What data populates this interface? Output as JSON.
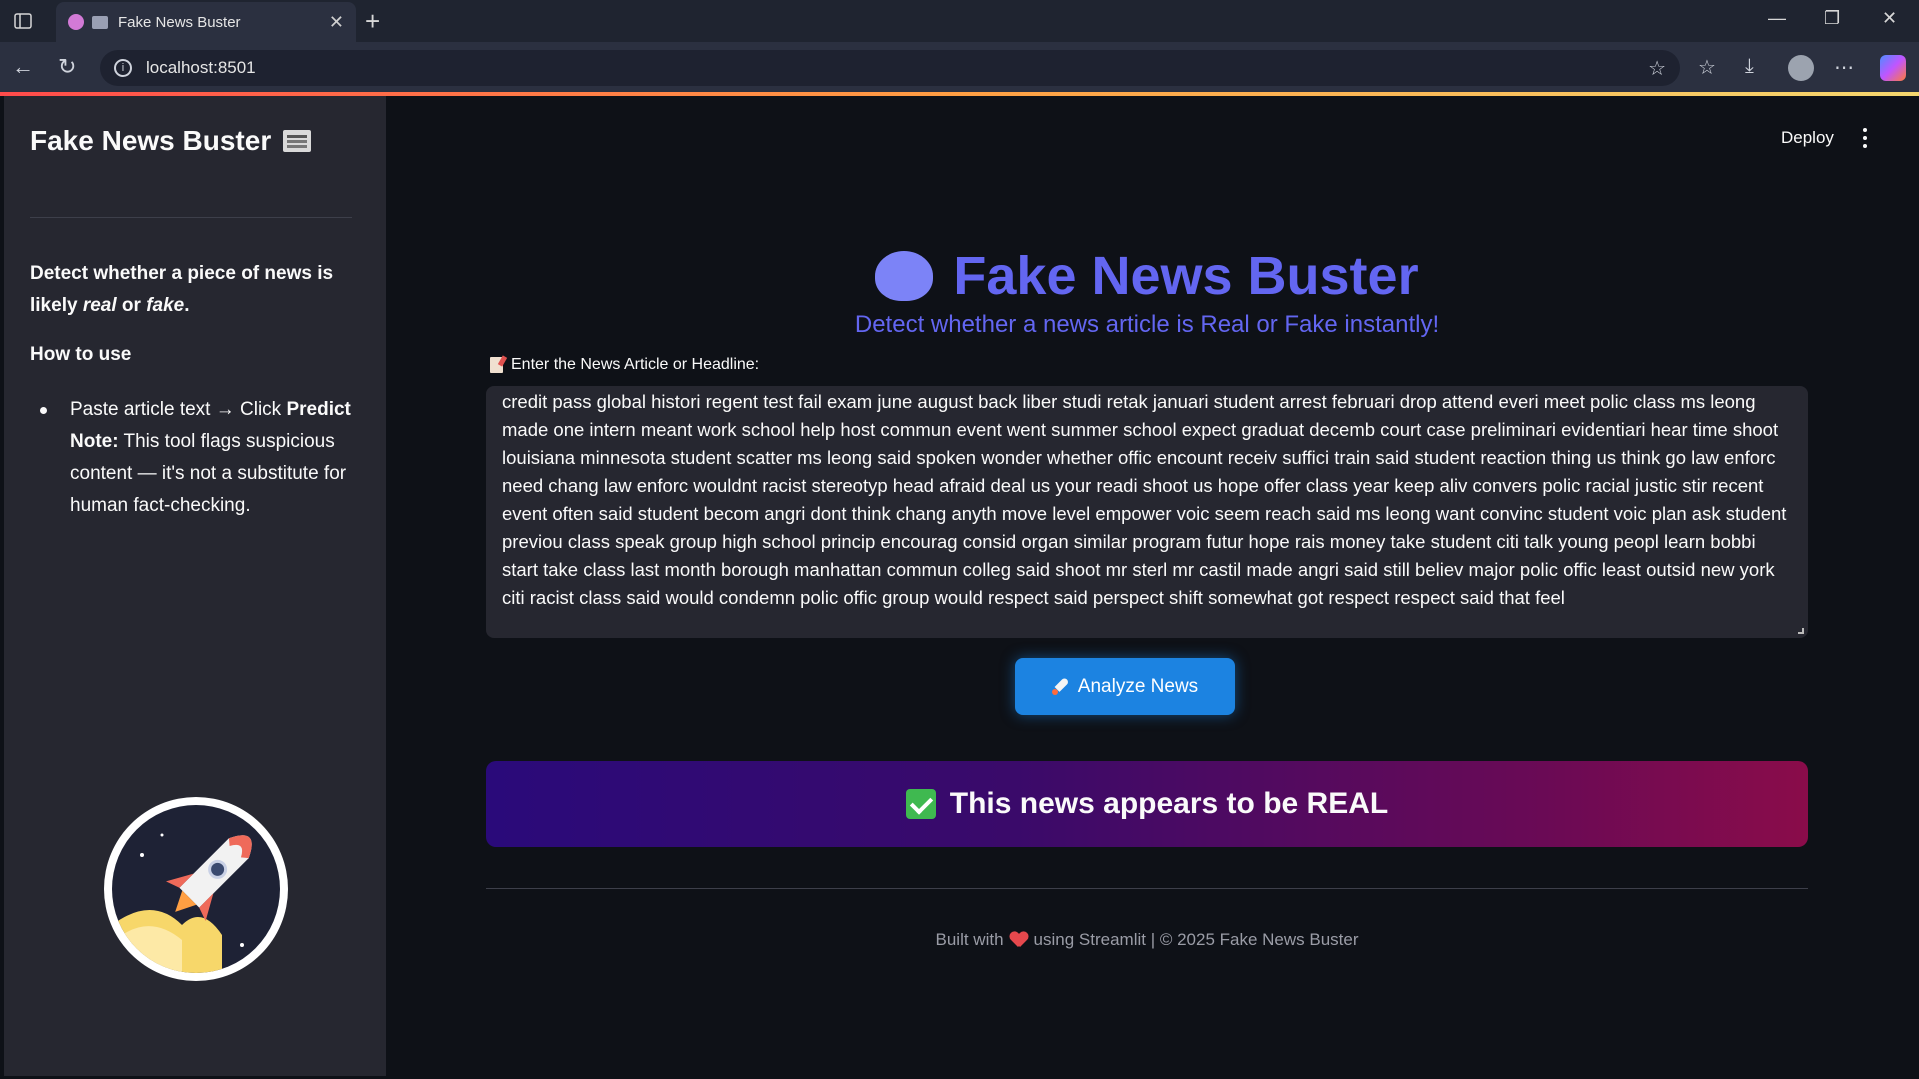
{
  "browser": {
    "tab_title": "Fake News Buster",
    "url": "localhost:8501"
  },
  "sidebar": {
    "title": "Fake News Buster",
    "desc_prefix": "Detect whether a piece of news is likely ",
    "desc_real": "real",
    "desc_or": " or ",
    "desc_fake": "fake",
    "desc_suffix": ".",
    "how_to_use": "How to use",
    "step_text": "Paste article text → Click ",
    "step_bold": "Predict",
    "note_label": "Note:",
    "note_text": " This tool flags suspicious content — it's not a substitute for human fact-checking."
  },
  "header": {
    "deploy_label": "Deploy"
  },
  "main": {
    "title": "Fake News Buster",
    "subtitle": "Detect whether a news article is Real or Fake instantly!",
    "input_label": "Enter the News Article or Headline:",
    "input_value": "credit pass global histori regent test fail exam june august back liber studi retak januari student arrest februari drop attend everi meet polic class ms leong made one intern meant work school help host commun event went summer school expect graduat decemb court case preliminari evidentiari hear time shoot louisiana minnesota student scatter ms leong said spoken wonder whether offic encount receiv suffici train said student reaction thing us think go law enforc need chang law enforc wouldnt racist stereotyp head afraid deal us your readi shoot us hope offer class year keep aliv convers polic racial justic stir recent event often said student becom angri dont think chang anyth move level empower voic seem reach said ms leong want convinc student voic plan ask student previou class speak group high school princip encourag consid organ similar program futur hope rais money take student citi talk young peopl learn bobbi start take class last month borough manhattan commun colleg said shoot mr sterl mr castil made angri said still believ major polic offic least outsid new york citi racist class said would condemn polic offic group would respect said perspect shift somewhat got respect respect said that feel",
    "analyze_button": "Analyze News",
    "result_text": "This news appears to be REAL"
  },
  "footer": {
    "built_with": "Built with",
    "using": "using Streamlit | © 2025 Fake News Buster"
  },
  "colors": {
    "accent": "#6366f1",
    "button": "#1c83e1",
    "background": "#0e1117",
    "sidebar": "#262730"
  }
}
